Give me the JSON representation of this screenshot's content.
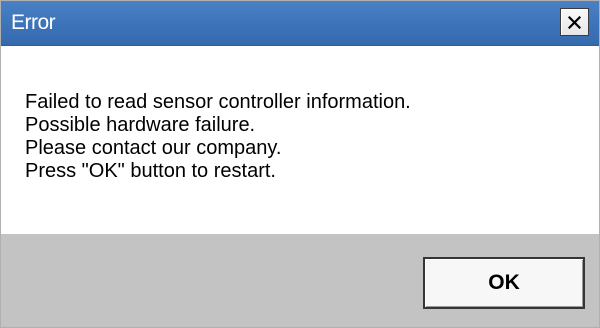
{
  "dialog": {
    "title": "Error",
    "close_icon": "close-icon",
    "message_lines": [
      "Failed to read sensor controller information.",
      "Possible hardware failure.",
      "Please contact our company.",
      "Press \"OK\" button to restart."
    ],
    "ok_label": "OK"
  },
  "colors": {
    "titlebar": "#3f75bb",
    "title_text": "#ffffff",
    "content_background": "#ffffff",
    "footer_background": "#c3c3c3",
    "button_face": "#f7f7f7"
  }
}
